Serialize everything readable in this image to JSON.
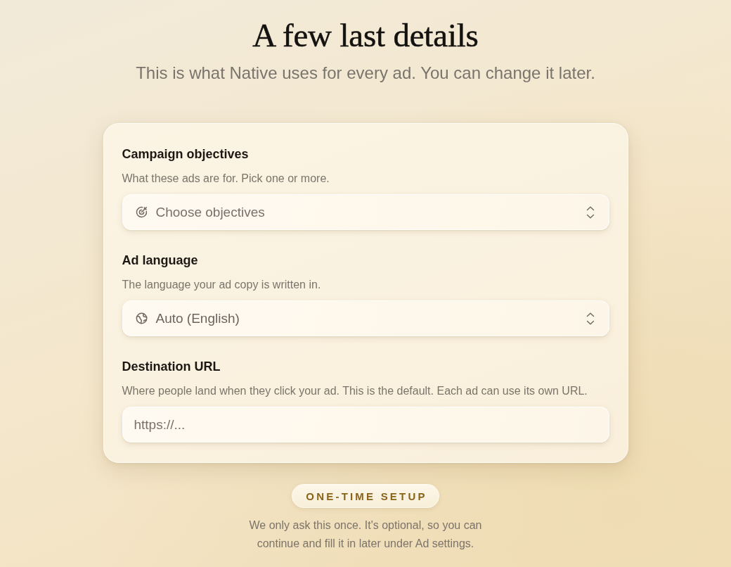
{
  "header": {
    "title": "A few last details",
    "subtitle": "This is what Native uses for every ad. You can change it later."
  },
  "form": {
    "fields": [
      {
        "kind": "select",
        "label": "Campaign objectives",
        "description": "What these ads are for. Pick one or more.",
        "placeholder": "Choose objectives"
      },
      {
        "kind": "select",
        "label": "Ad language",
        "description": "The language your ad copy is written in.",
        "value": "Auto (English)"
      },
      {
        "kind": "text",
        "label": "Destination URL",
        "description": "Where people land when they click your ad. This is the default. Each ad can use its own URL.",
        "placeholder": "https://..."
      }
    ]
  },
  "footer": {
    "badge": "ONE-TIME SETUP",
    "note": "We only ask this once. It's optional, so you can continue and fill it in later under Ad settings."
  }
}
